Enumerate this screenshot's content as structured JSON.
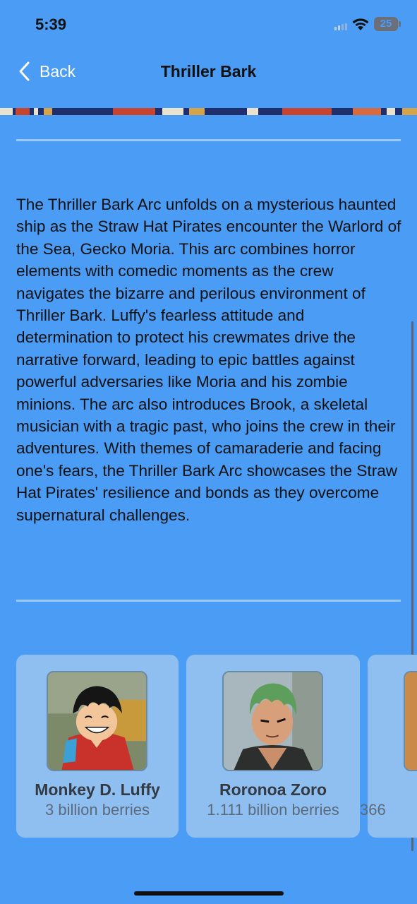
{
  "status_bar": {
    "time": "5:39",
    "battery": "25"
  },
  "nav": {
    "back_label": "Back",
    "title": "Thriller Bark"
  },
  "arc": {
    "description": "The Thriller Bark Arc unfolds on a mysterious haunted ship as the Straw Hat Pirates encounter the Warlord of the Sea, Gecko Moria. This arc combines horror elements with comedic moments as the crew navigates the bizarre and perilous environment of Thriller Bark. Luffy's fearless attitude and determination to protect his crewmates drive the narrative forward, leading to epic battles against powerful adversaries like Moria and his zombie minions. The arc also introduces Brook, a skeletal musician with a tragic past, who joins the crew in their adventures. With themes of camaraderie and facing one's fears, the Thriller Bark Arc showcases the Straw Hat Pirates' resilience and bonds as they overcome supernatural challenges."
  },
  "characters": [
    {
      "name": "Monkey D. Luffy",
      "bounty": "3 billion berries"
    },
    {
      "name": "Roronoa Zoro",
      "bounty": "1.111 billion berries"
    },
    {
      "name": "",
      "bounty": "366"
    }
  ],
  "colors": {
    "background": "#4a9cf5",
    "card": "#8fbff0",
    "divider": "#9ccaf8",
    "nav_accent": "#ffffff"
  }
}
